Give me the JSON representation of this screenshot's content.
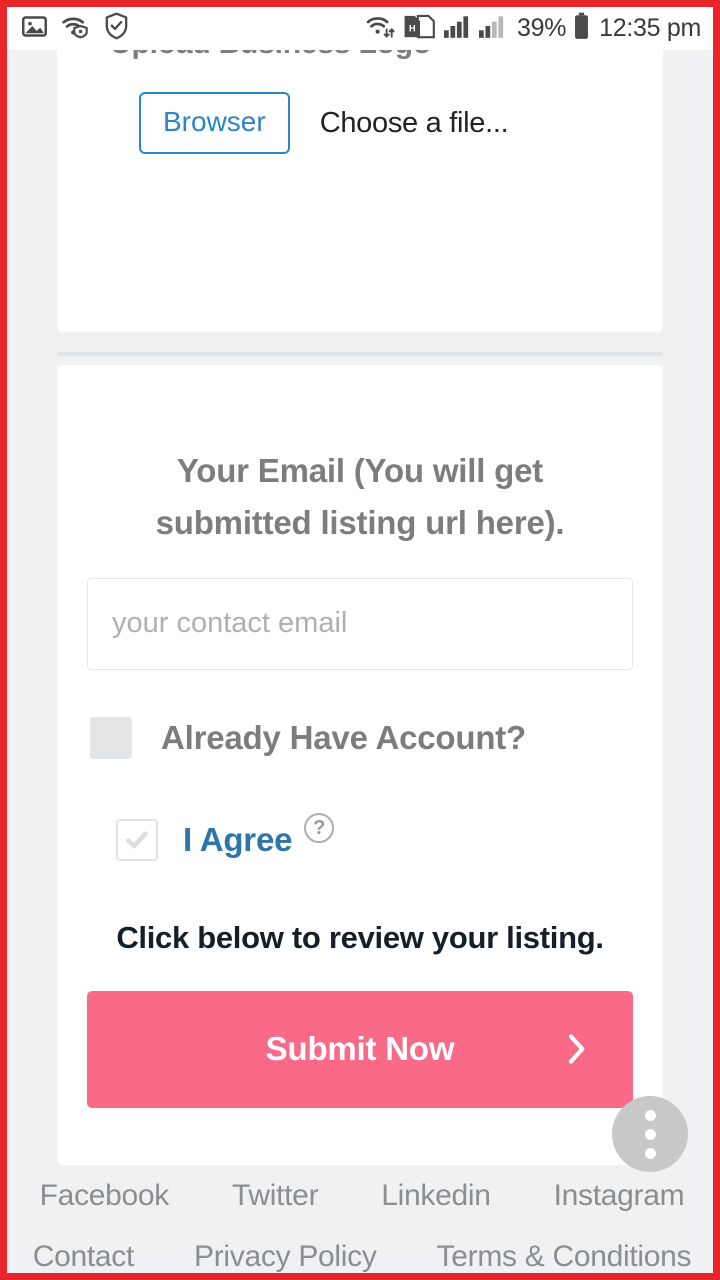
{
  "status_bar": {
    "left_icons": [
      "screenshot-icon",
      "wifi-protected-icon",
      "shield-check-icon"
    ],
    "right_icons": [
      "wifi-transfer-icon",
      "sim-hd-icon",
      "signal-bars-icon",
      "signal-bars-2-icon",
      "battery-icon"
    ],
    "battery_percent": "39%",
    "clock": "12:35 pm"
  },
  "upload_card": {
    "title": "Upload Business Logo",
    "browse_button": "Browser",
    "file_name": "Choose a file..."
  },
  "submit_card": {
    "email_label": "Your Email (You will get submitted listing url here).",
    "email_value": "",
    "email_placeholder": "your contact email",
    "already_have_account_label": "Already Have Account?",
    "already_have_account_checked": false,
    "agree_label": "I Agree",
    "agree_checked": true,
    "help_icon_glyph": "?",
    "review_note": "Click below to review your listing.",
    "submit_button": "Submit Now",
    "submit_chevron": "chevron-right-icon"
  },
  "fab": {
    "name": "more-options-icon"
  },
  "footer": {
    "social_links": [
      "Facebook",
      "Twitter",
      "Linkedin",
      "Instagram"
    ],
    "page_links": [
      "Contact",
      "Privacy Policy",
      "Terms & Conditions"
    ]
  },
  "colors": {
    "frame_red": "#e8252a",
    "page_background": "#eff1f3",
    "accent_blue": "#2a86c8",
    "agree_blue": "#2e75a8",
    "submit_pink": "#f96a89",
    "muted_text": "#7d7d7d",
    "footer_text": "#8b8e91"
  }
}
